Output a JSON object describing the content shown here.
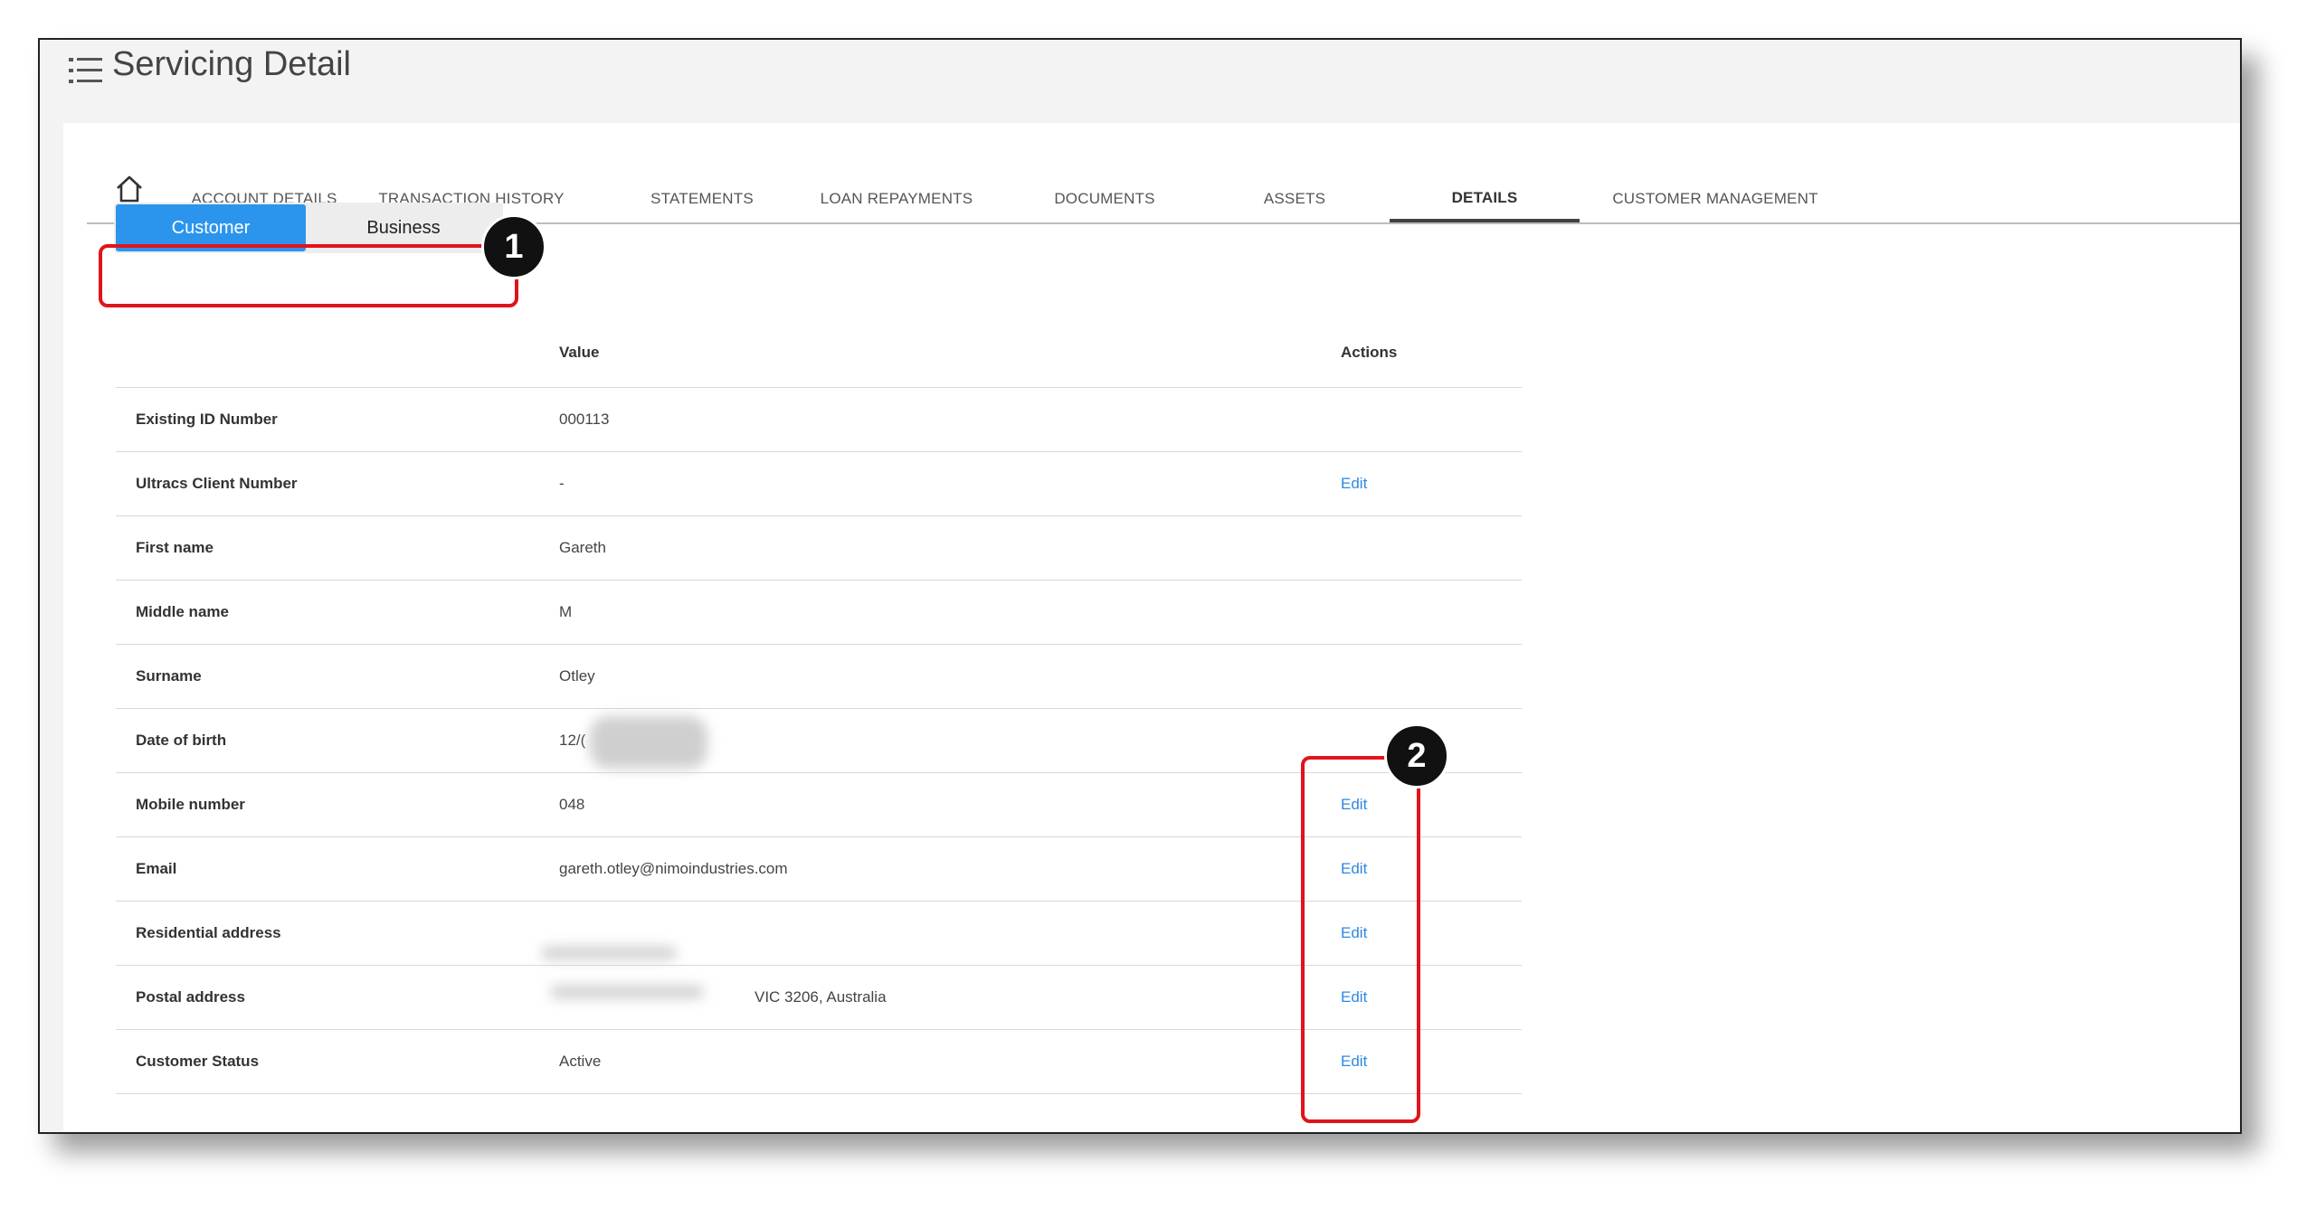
{
  "header": {
    "title": "Servicing Detail"
  },
  "tabs": [
    {
      "label": "ACCOUNT DETAILS"
    },
    {
      "label": "TRANSACTION HISTORY"
    },
    {
      "label": "STATEMENTS"
    },
    {
      "label": "LOAN REPAYMENTS"
    },
    {
      "label": "DOCUMENTS"
    },
    {
      "label": "ASSETS"
    },
    {
      "label": "DETAILS"
    },
    {
      "label": "CUSTOMER MANAGEMENT"
    }
  ],
  "segment": {
    "customer": "Customer",
    "business": "Business"
  },
  "table": {
    "col_value": "Value",
    "col_actions": "Actions",
    "edit_label": "Edit",
    "rows": [
      {
        "label": "Existing ID Number",
        "value": "000113"
      },
      {
        "label": "Ultracs Client Number",
        "value": "-"
      },
      {
        "label": "First name",
        "value": "Gareth"
      },
      {
        "label": "Middle name",
        "value": "M"
      },
      {
        "label": "Surname",
        "value": "Otley"
      },
      {
        "label": "Date of birth",
        "value": "12/("
      },
      {
        "label": "Mobile number",
        "value": "048"
      },
      {
        "label": "Email",
        "value": "gareth.otley@nimoindustries.com"
      },
      {
        "label": "Residential address",
        "value": ""
      },
      {
        "label": "Postal address",
        "value": "VIC 3206, Australia"
      },
      {
        "label": "Customer Status",
        "value": "Active"
      }
    ]
  },
  "callouts": {
    "one": "1",
    "two": "2"
  },
  "colors": {
    "accent": "#2b95ee",
    "link": "#2b8ae2",
    "callout": "#e0141b"
  }
}
